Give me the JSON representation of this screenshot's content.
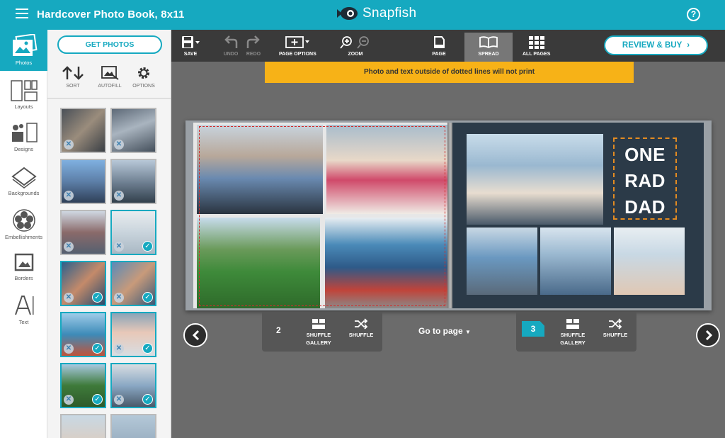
{
  "header": {
    "title": "Hardcover Photo Book, 8x11",
    "brand": "Snapfish",
    "help": "?"
  },
  "leftnav": [
    {
      "label": "Photos",
      "icon": "photos-icon"
    },
    {
      "label": "Layouts",
      "icon": "layouts-icon"
    },
    {
      "label": "Designs",
      "icon": "designs-icon"
    },
    {
      "label": "Backgrounds",
      "icon": "backgrounds-icon"
    },
    {
      "label": "Embellishments",
      "icon": "embellishments-icon"
    },
    {
      "label": "Borders",
      "icon": "borders-icon"
    },
    {
      "label": "Text",
      "icon": "text-icon"
    }
  ],
  "panel": {
    "get_photos": "GET PHOTOS",
    "tools": [
      {
        "label": "SORT",
        "icon": "sort-icon"
      },
      {
        "label": "AUTOFILL",
        "icon": "autofill-icon"
      },
      {
        "label": "OPTIONS",
        "icon": "gear-icon"
      }
    ]
  },
  "toolbar": {
    "save": "SAVE",
    "undo": "UNDO",
    "redo": "REDO",
    "page_options": "PAGE OPTIONS",
    "zoom": "ZOOM",
    "page": "PAGE",
    "spread": "SPREAD",
    "all_pages": "ALL PAGES",
    "review_buy": "REVIEW & BUY"
  },
  "warning": "Photo and text outside of dotted lines will not print",
  "right_page_text": [
    "ONE",
    "RAD",
    "DAD"
  ],
  "page_controls": {
    "left_page": "2",
    "right_page": "3",
    "shuffle_gallery": "SHUFFLE GALLERY",
    "shuffle": "SHUFFLE",
    "goto": "Go to page"
  },
  "colors": {
    "accent": "#16a9c0",
    "warning": "#f7b217",
    "right_page_bg": "#2b3a48"
  }
}
